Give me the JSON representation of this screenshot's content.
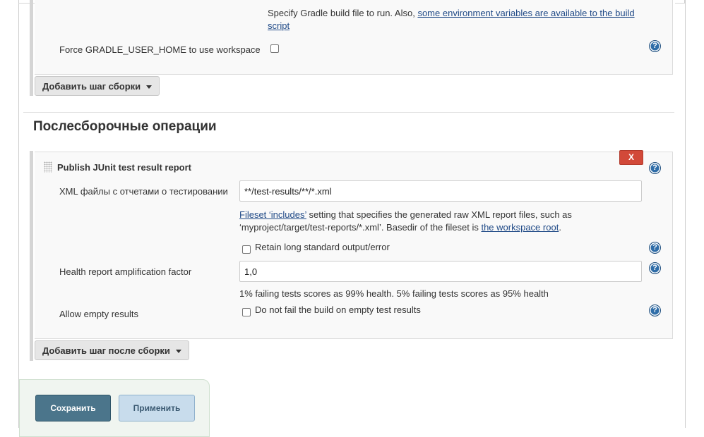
{
  "build": {
    "gradle_help_text": "Specify Gradle build file to run. Also, ",
    "gradle_help_link": "some environment variables are available to the build",
    "gradle_help_link_cont": "script",
    "force_home_label": "Force GRADLE_USER_HOME to use workspace",
    "add_build_step_label": "Добавить шаг сборки"
  },
  "post_build": {
    "section_title": "Послесборочные операции",
    "junit": {
      "title": "Publish JUnit test result report",
      "delete_label": "X",
      "xml_label": "XML файлы с отчетами о тестировании",
      "xml_value": "**/test-results/**/*.xml",
      "fileset_link": "Fileset ‘includes’",
      "fileset_text": " setting that specifies the generated raw XML report files, such as",
      "fileset_text2": "‘myproject/target/test-reports/*.xml’. Basedir of the fileset is ",
      "workspace_link": "the workspace root",
      "fileset_period": ".",
      "retain_label": "Retain long standard output/error",
      "health_label": "Health report amplification factor",
      "health_value": "1,0",
      "health_hint": "1% failing tests scores as 99% health. 5% failing tests scores as 95% health",
      "allow_empty_label": "Allow empty results",
      "allow_empty_checkbox_label": "Do not fail the build on empty test results"
    },
    "add_post_step_label": "Добавить шаг после сборки"
  },
  "actions": {
    "save_label": "Сохранить",
    "apply_label": "Применить"
  },
  "icons": {
    "help": "help-icon",
    "help_glyph": "?"
  },
  "colors": {
    "save_bg": "#4b758b",
    "apply_bg": "#c8dcec",
    "delete_bg": "#d24939",
    "help_icon": "#2f6da8"
  }
}
